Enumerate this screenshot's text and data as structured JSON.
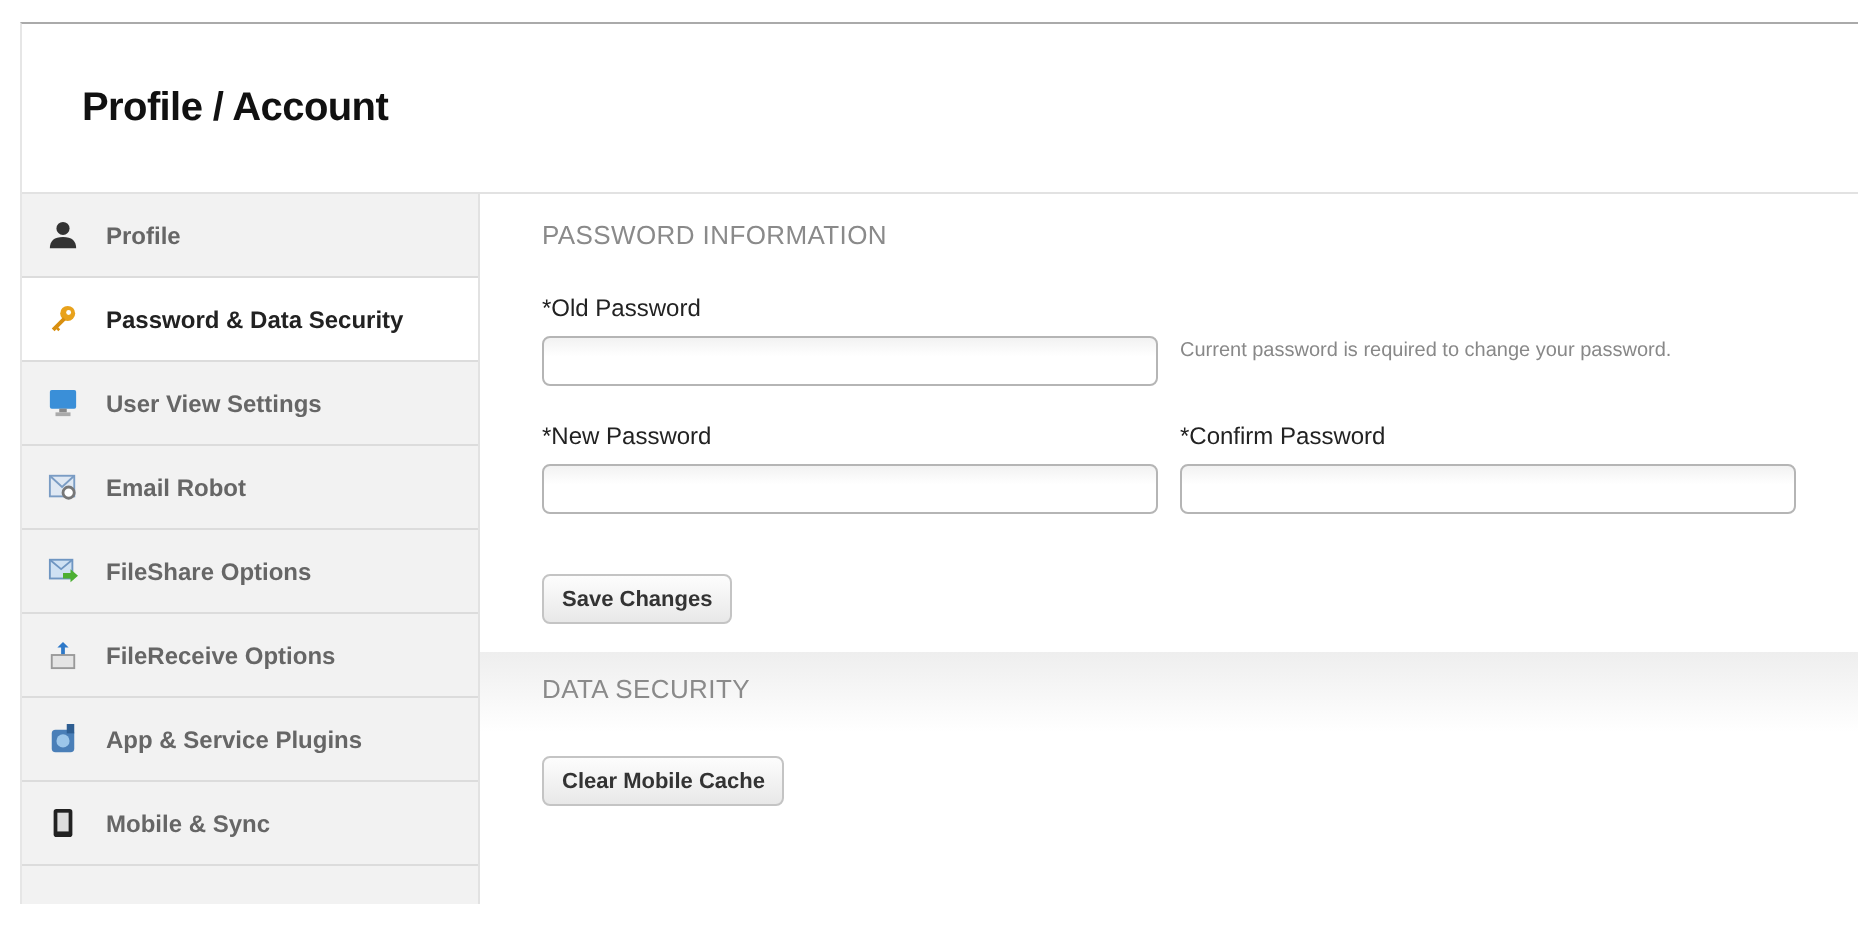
{
  "page_title": "Profile / Account",
  "sidebar": {
    "items": [
      {
        "label": "Profile",
        "selected": false
      },
      {
        "label": "Password & Data Security",
        "selected": true
      },
      {
        "label": "User View Settings",
        "selected": false
      },
      {
        "label": "Email Robot",
        "selected": false
      },
      {
        "label": "FileShare Options",
        "selected": false
      },
      {
        "label": "FileReceive Options",
        "selected": false
      },
      {
        "label": "App & Service Plugins",
        "selected": false
      },
      {
        "label": "Mobile & Sync",
        "selected": false
      }
    ]
  },
  "password_section": {
    "heading": "PASSWORD INFORMATION",
    "old_password": {
      "label": "*Old Password",
      "hint": "Current password is required to change your password."
    },
    "new_password": {
      "label": "*New Password"
    },
    "confirm_password": {
      "label": "*Confirm Password"
    },
    "save_button": "Save Changes"
  },
  "data_security_section": {
    "heading": "DATA SECURITY",
    "clear_button": "Clear Mobile Cache"
  }
}
